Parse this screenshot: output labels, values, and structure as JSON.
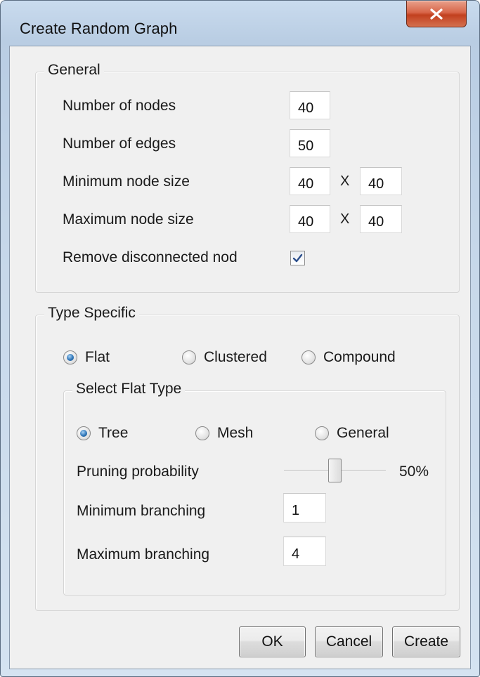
{
  "window": {
    "title": "Create Random Graph"
  },
  "general": {
    "legend": "General",
    "num_nodes_label": "Number of nodes",
    "num_nodes_value": "40",
    "num_edges_label": "Number of edges",
    "num_edges_value": "50",
    "min_size_label": "Minimum node size",
    "min_width": "40",
    "min_height": "40",
    "max_size_label": "Maximum node size",
    "max_width": "40",
    "max_height": "40",
    "separator": "X",
    "remove_disconnected_label": "Remove disconnected nod",
    "remove_disconnected_checked": true
  },
  "type_specific": {
    "legend": "Type Specific",
    "options": [
      "Flat",
      "Clustered",
      "Compound"
    ],
    "selected": "Flat",
    "flat": {
      "legend": "Select Flat Type",
      "options": [
        "Tree",
        "Mesh",
        "General"
      ],
      "selected": "Tree",
      "pruning_label": "Pruning probability",
      "pruning_value": 50,
      "pruning_display": "50%",
      "min_branching_label": "Minimum branching",
      "min_branching_value": "1",
      "max_branching_label": "Maximum branching",
      "max_branching_value": "4"
    }
  },
  "buttons": {
    "ok": "OK",
    "cancel": "Cancel",
    "create": "Create"
  }
}
